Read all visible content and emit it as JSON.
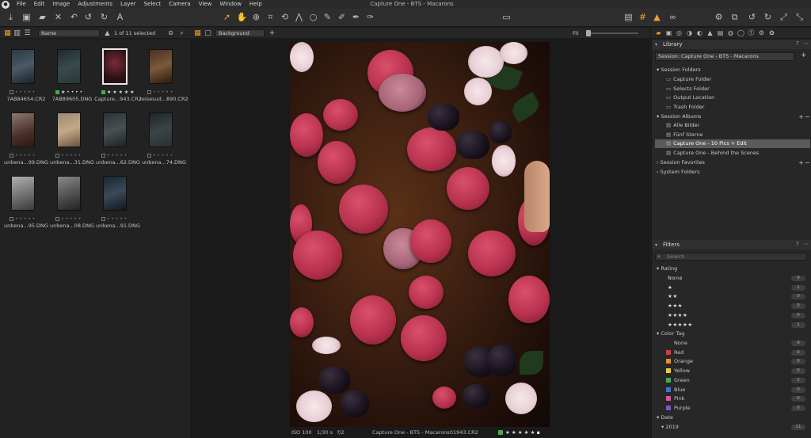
{
  "app": {
    "window_title": "Capture One - BTS - Macarons"
  },
  "menu": [
    "File",
    "Edit",
    "Image",
    "Adjustments",
    "Layer",
    "Select",
    "Camera",
    "View",
    "Window",
    "Help"
  ],
  "browser": {
    "sort_value": "Name",
    "count_label": "1 of 11 selected",
    "thumbs": [
      {
        "name": "7AB84654.CR2",
        "stars": 0,
        "tag": "none"
      },
      {
        "name": "7AB89605.DNG",
        "stars": 1,
        "tag": "green"
      },
      {
        "name": "Capture...943.CR2",
        "stars": 5,
        "tag": "green",
        "selected": true
      },
      {
        "name": "reisesud...890.CR2",
        "stars": 0,
        "tag": "none"
      },
      {
        "name": "unbena...99.DNG",
        "stars": 0,
        "tag": "none"
      },
      {
        "name": "unbena...31.DNG",
        "stars": 0,
        "tag": "none"
      },
      {
        "name": "unbena...62.DNG",
        "stars": 0,
        "tag": "none"
      },
      {
        "name": "unbena...74.DNG",
        "stars": 0,
        "tag": "none"
      },
      {
        "name": "unbena...95.DNG",
        "stars": 0,
        "tag": "none"
      },
      {
        "name": "unbena...08.DNG",
        "stars": 0,
        "tag": "none"
      },
      {
        "name": "unbena...91.DNG",
        "stars": 0,
        "tag": "none"
      }
    ]
  },
  "viewer": {
    "layer_select": "Background",
    "fit_label": "Fit",
    "iso": "ISO 100",
    "shutter": "1/30 s",
    "aperture": "f/2",
    "filename": "Capture One - BTS - Macarons01943.CR2"
  },
  "library": {
    "title": "Library",
    "session_select": "Session: Capture One - BTS - Macarons",
    "session_folders_label": "Session Folders",
    "folders": [
      "Capture Folder",
      "Selects Folder",
      "Output Location",
      "Trash Folder"
    ],
    "session_albums_label": "Session Albums",
    "albums": [
      "Alle Bilder",
      "Fünf Sterne",
      "Capture One - 10 Pics + Edit",
      "Capture One - Behind the Scenes"
    ],
    "session_favorites_label": "Session Favorites",
    "system_folders_label": "System Folders"
  },
  "filters": {
    "title": "Filters",
    "search_placeholder": "Search",
    "rating_label": "Rating",
    "ratings": [
      {
        "label": "None",
        "count": "9"
      },
      {
        "label": "★",
        "count": "1"
      },
      {
        "label": "★★",
        "count": "0"
      },
      {
        "label": "★★★",
        "count": "0"
      },
      {
        "label": "★★★★",
        "count": "0"
      },
      {
        "label": "★★★★★",
        "count": "1"
      }
    ],
    "color_tag_label": "Color Tag",
    "color_tags": [
      {
        "label": "None",
        "count": "9",
        "color": ""
      },
      {
        "label": "Red",
        "count": "0",
        "color": "#e0363f"
      },
      {
        "label": "Orange",
        "count": "0",
        "color": "#f08a24"
      },
      {
        "label": "Yellow",
        "count": "0",
        "color": "#e6cf2a"
      },
      {
        "label": "Green",
        "count": "2",
        "color": "#39b54a"
      },
      {
        "label": "Blue",
        "count": "0",
        "color": "#3a74d8"
      },
      {
        "label": "Pink",
        "count": "0",
        "color": "#e04fa0"
      },
      {
        "label": "Purple",
        "count": "0",
        "color": "#8a4fd8"
      }
    ],
    "date_label": "Date",
    "date_year": "2019",
    "date_year_count": "11"
  }
}
